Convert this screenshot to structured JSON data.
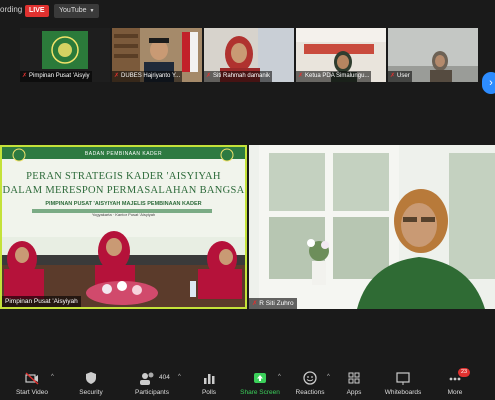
{
  "topbar": {
    "recording_text": "ording",
    "live_badge": "LIVE",
    "stream_target": "YouTube"
  },
  "participants_strip": [
    {
      "name": "Pimpinan Pusat 'Aisyiy"
    },
    {
      "name": "DUBES Hajriyanto Y..."
    },
    {
      "name": "Siti Rahmah damanik"
    },
    {
      "name": "Ketua PDA Simalungu..."
    },
    {
      "name": "User"
    }
  ],
  "banner": {
    "org": "BADAN PEMBINAAN KADER",
    "line1": "PERAN STRATEGIS KADER 'AISYIYAH",
    "line2": "DALAM MERESPON PERMASALAHAN BANGSA",
    "line3": "PIMPINAN PUSAT 'AISYIYAH MAJELIS PEMBINAAN KADER",
    "venue_left": "Yogyakarta",
    "venue_right": "Kantor Pusat 'Aisyiyah"
  },
  "main_tiles": {
    "left_name": "Pimpinan Pusat 'Aisyiyah",
    "right_name": "R Siti Zuhro"
  },
  "toolbar": {
    "start_video": "Start Video",
    "security": "Security",
    "participants": "Participants",
    "participants_count": "404",
    "polls": "Polls",
    "share_screen": "Share Screen",
    "reactions": "Reactions",
    "apps": "Apps",
    "whiteboards": "Whiteboards",
    "more": "More",
    "more_badge": "23"
  },
  "colors": {
    "accent_active": "#c4e23a",
    "share_green": "#3bd05a",
    "live_red": "#e0312f",
    "arrow_blue": "#2d8cff"
  }
}
